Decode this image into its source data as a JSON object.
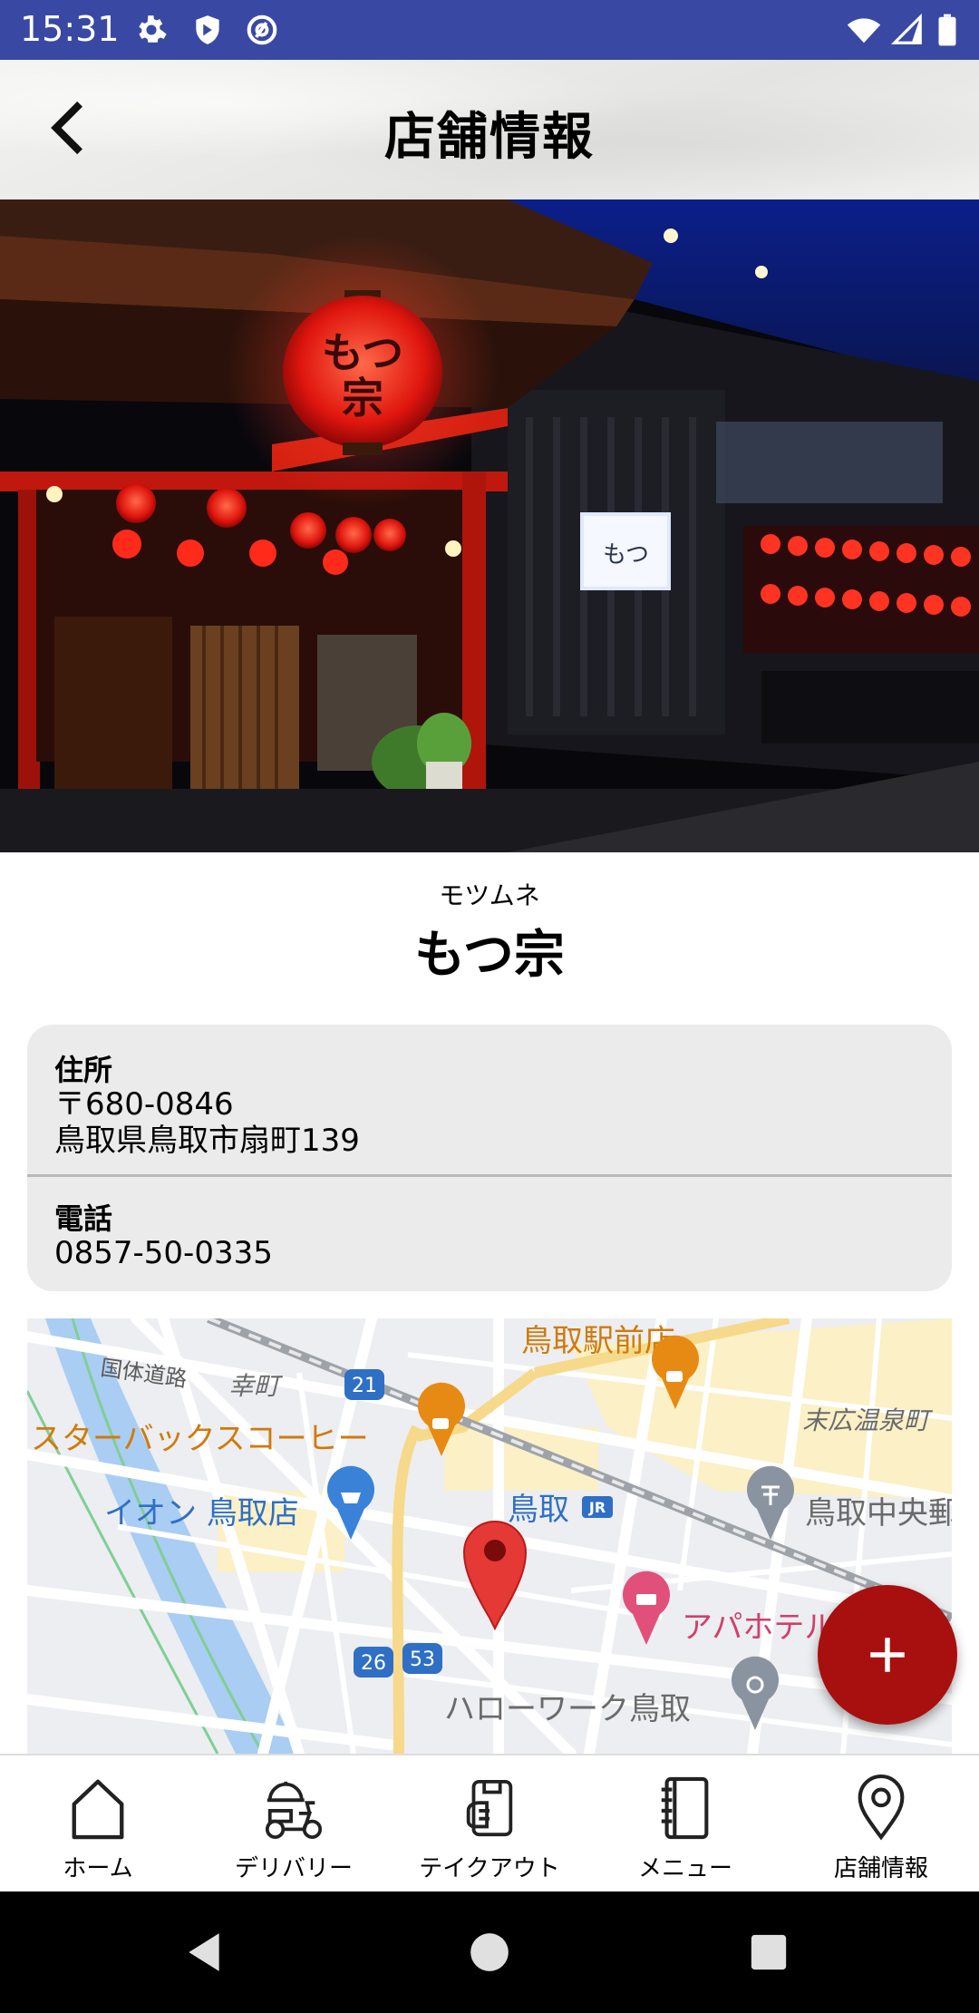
{
  "status_bar": {
    "time": "15:31"
  },
  "app_bar": {
    "title": "店舗情報"
  },
  "shop": {
    "kana": "モツムネ",
    "name": "もつ宗"
  },
  "info": {
    "address_label": "住所",
    "postal": "〒680-0846",
    "address": "鳥取県鳥取市扇町139",
    "phone_label": "電話",
    "phone": "0857-50-0335"
  },
  "map": {
    "labels": {
      "station_store": "鳥取駅前店",
      "kokutai_road": "国体道路",
      "saiwai_cho": "幸町",
      "suehiro_onsen": "末広温泉町",
      "starbucks": "スターバックスコーヒー",
      "aeon": "イオン 鳥取店",
      "tottori": "鳥取",
      "tottori_central": "鳥取中央郵",
      "apa_hotel": "アパホテル",
      "hellowork": "ハローワーク鳥取"
    },
    "route_badges": [
      "21",
      "26",
      "53"
    ],
    "jr_mark": "JR"
  },
  "bottom_nav": [
    {
      "label": "ホーム",
      "icon": "home-icon"
    },
    {
      "label": "デリバリー",
      "icon": "delivery-scooter-icon"
    },
    {
      "label": "テイクアウト",
      "icon": "takeout-bag-icon"
    },
    {
      "label": "メニュー",
      "icon": "menu-book-icon"
    },
    {
      "label": "店舗情報",
      "icon": "location-pin-icon"
    }
  ],
  "colors": {
    "status_bar": "#3949a3",
    "fab": "#a80f0f",
    "map_pin": "#e53935",
    "text": "#000000"
  }
}
